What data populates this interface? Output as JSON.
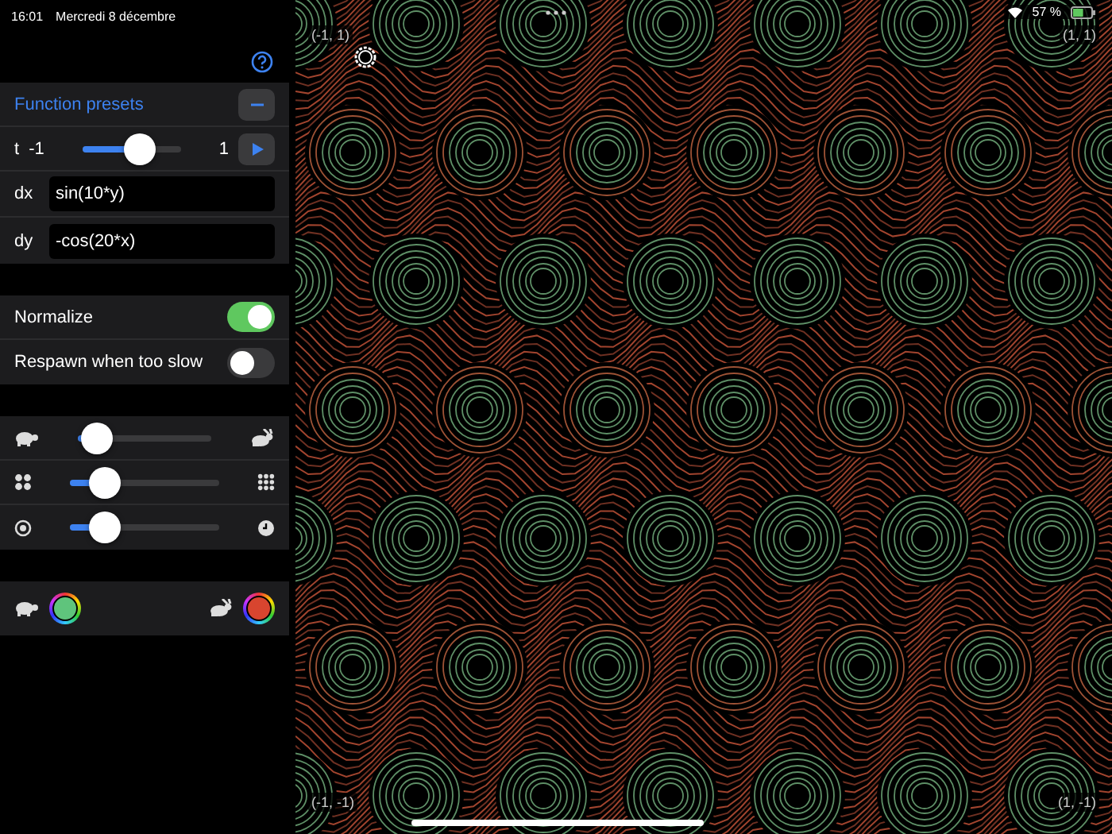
{
  "status_bar": {
    "time": "16:01",
    "date": "Mercredi 8 décembre",
    "battery": "57 %"
  },
  "presets": {
    "title": "Function presets",
    "expanded": true
  },
  "t_slider": {
    "label": "t",
    "min": "-1",
    "max": "1",
    "level": 0.58,
    "playing": false
  },
  "fields": [
    {
      "label": "dx",
      "value": "sin(10*y)"
    },
    {
      "label": "dy",
      "value": "-cos(20*x)"
    }
  ],
  "toggles": [
    {
      "label": "Normalize",
      "on": true
    },
    {
      "label": "Respawn when too slow",
      "on": false
    }
  ],
  "sliders": [
    {
      "kind": "speed",
      "level": 0.14
    },
    {
      "kind": "density",
      "level": 0.23
    },
    {
      "kind": "lifetime",
      "level": 0.23
    }
  ],
  "colors": [
    {
      "kind": "slow",
      "color": "#5fc47c"
    },
    {
      "kind": "fast",
      "color": "#d8452f"
    }
  ],
  "canvas": {
    "corners": [
      "(-1, 1)",
      "(1, 1)",
      "(-1, -1)",
      "(1, -1)"
    ]
  }
}
